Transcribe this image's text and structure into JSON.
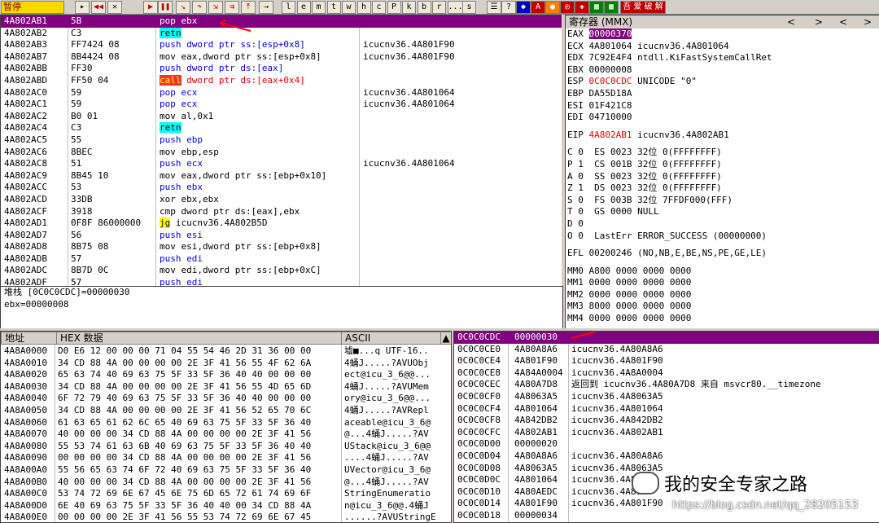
{
  "toolbar": {
    "status": "暂停",
    "buttons": [
      "l",
      "e",
      "m",
      "t",
      "w",
      "h",
      "c",
      "P",
      "k",
      "b",
      "r",
      "...",
      "s"
    ]
  },
  "disasm": {
    "rows": [
      {
        "addr": "4A802AB1",
        "hex": "5B",
        "asm": "pop ebx",
        "cmt": ""
      },
      {
        "addr": "4A802AB2",
        "hex": "C3",
        "asm": "retn",
        "cmt": ""
      },
      {
        "addr": "4A802AB3",
        "hex": "FF7424 08",
        "asm": "push dword ptr ss:[esp+0x8]",
        "cmt": "icucnv36.4A801F90"
      },
      {
        "addr": "4A802AB7",
        "hex": "8B4424 08",
        "asm": "mov eax,dword ptr ss:[esp+0x8]",
        "cmt": "icucnv36.4A801F90"
      },
      {
        "addr": "4A802ABB",
        "hex": "FF30",
        "asm": "push dword ptr ds:[eax]",
        "cmt": ""
      },
      {
        "addr": "4A802ABD",
        "hex": "FF50 04",
        "asm": "call dword ptr ds:[eax+0x4]",
        "cmt": ""
      },
      {
        "addr": "4A802AC0",
        "hex": "59",
        "asm": "pop ecx",
        "cmt": "icucnv36.4A801064"
      },
      {
        "addr": "4A802AC1",
        "hex": "59",
        "asm": "pop ecx",
        "cmt": "icucnv36.4A801064"
      },
      {
        "addr": "4A802AC2",
        "hex": "B0 01",
        "asm": "mov al,0x1",
        "cmt": ""
      },
      {
        "addr": "4A802AC4",
        "hex": "C3",
        "asm": "retn",
        "cmt": ""
      },
      {
        "addr": "4A802AC5",
        "hex": "55",
        "asm": "push ebp",
        "cmt": ""
      },
      {
        "addr": "4A802AC6",
        "hex": "8BEC",
        "asm": "mov ebp,esp",
        "cmt": ""
      },
      {
        "addr": "4A802AC8",
        "hex": "51",
        "asm": "push ecx",
        "cmt": "icucnv36.4A801064"
      },
      {
        "addr": "4A802AC9",
        "hex": "8B45 10",
        "asm": "mov eax,dword ptr ss:[ebp+0x10]",
        "cmt": ""
      },
      {
        "addr": "4A802ACC",
        "hex": "53",
        "asm": "push ebx",
        "cmt": ""
      },
      {
        "addr": "4A802ACD",
        "hex": "33DB",
        "asm": "xor ebx,ebx",
        "cmt": ""
      },
      {
        "addr": "4A802ACF",
        "hex": "3918",
        "asm": "cmp dword ptr ds:[eax],ebx",
        "cmt": ""
      },
      {
        "addr": "4A802AD1",
        "hex": "0F8F 86000000",
        "asm": "jg icucnv36.4A802B5D",
        "cmt": ""
      },
      {
        "addr": "4A802AD7",
        "hex": "56",
        "asm": "push esi",
        "cmt": ""
      },
      {
        "addr": "4A802AD8",
        "hex": "8B75 08",
        "asm": "mov esi,dword ptr ss:[ebp+0x8]",
        "cmt": ""
      },
      {
        "addr": "4A802ADB",
        "hex": "57",
        "asm": "push edi",
        "cmt": ""
      },
      {
        "addr": "4A802ADC",
        "hex": "8B7D 0C",
        "asm": "mov edi,dword ptr ss:[ebp+0xC]",
        "cmt": ""
      },
      {
        "addr": "4A802ADF",
        "hex": "57",
        "asm": "push edi",
        "cmt": ""
      }
    ]
  },
  "info": {
    "line1": "堆栈 [0C0C0CDC]=00000030",
    "line2": "ebx=00000008"
  },
  "registers": {
    "title": "寄存器 (MMX)",
    "lines": [
      "EAX 00000370",
      "ECX 4A801064 icucnv36.4A801064",
      "EDX 7C92E4F4 ntdll.KiFastSystemCallRet",
      "EBX 00000008",
      "ESP 0C0C0CDC UNICODE \"0\"",
      "EBP DA55D18A",
      "ESI 01F421C8",
      "EDI 04710000",
      "",
      "EIP 4A802AB1 icucnv36.4A802AB1",
      "",
      "C 0  ES 0023 32位 0(FFFFFFFF)",
      "P 1  CS 001B 32位 0(FFFFFFFF)",
      "A 0  SS 0023 32位 0(FFFFFFFF)",
      "Z 1  DS 0023 32位 0(FFFFFFFF)",
      "S 0  FS 003B 32位 7FFDF000(FFF)",
      "T 0  GS 0000 NULL",
      "D 0",
      "O 0  LastErr ERROR_SUCCESS (00000000)",
      "",
      "EFL 00200246 (NO,NB,E,BE,NS,PE,GE,LE)",
      "",
      "MM0 A800 0000 0000 0000",
      "MM1 0000 0000 0000 0000",
      "MM2 0000 0000 0000 0000",
      "MM3 8000 0000 0000 0000",
      "MM4 0000 0000 0000 0000"
    ]
  },
  "dump": {
    "headers": {
      "addr": "地址",
      "hex": "HEX 数据",
      "ascii": "ASCII"
    },
    "rows": [
      {
        "addr": "4A8A0000",
        "hex": "D0 E6 12 00 00 00 71 04 55 54 46 2D 31 36 00 00",
        "ascii": "墟■...q UTF-16.."
      },
      {
        "addr": "4A8A0010",
        "hex": "34 CD 88 4A 00 00 00 00 2E 3F 41 56 55 4F 62 6A",
        "ascii": "4蛹J.....?AVUObj"
      },
      {
        "addr": "4A8A0020",
        "hex": "65 63 74 40 69 63 75 5F 33 5F 36 40 40 00 00 00",
        "ascii": "ect@icu_3_6@@..."
      },
      {
        "addr": "4A8A0030",
        "hex": "34 CD 88 4A 00 00 00 00 2E 3F 41 56 55 4D 65 6D",
        "ascii": "4蛹J.....?AVUMem"
      },
      {
        "addr": "4A8A0040",
        "hex": "6F 72 79 40 69 63 75 5F 33 5F 36 40 40 00 00 00",
        "ascii": "ory@icu_3_6@@..."
      },
      {
        "addr": "4A8A0050",
        "hex": "34 CD 88 4A 00 00 00 00 2E 3F 41 56 52 65 70 6C",
        "ascii": "4蛹J.....?AVRepl"
      },
      {
        "addr": "4A8A0060",
        "hex": "61 63 65 61 62 6C 65 40 69 63 75 5F 33 5F 36 40",
        "ascii": "aceable@icu_3_6@"
      },
      {
        "addr": "4A8A0070",
        "hex": "40 00 00 00 34 CD 88 4A 00 00 00 00 2E 3F 41 56",
        "ascii": "@...4蛹J.....?AV"
      },
      {
        "addr": "4A8A0080",
        "hex": "55 53 74 61 63 6B 40 69 63 75 5F 33 5F 36 40 40",
        "ascii": "UStack@icu_3_6@@"
      },
      {
        "addr": "4A8A0090",
        "hex": "00 00 00 00 34 CD 88 4A 00 00 00 00 2E 3F 41 56",
        "ascii": "....4蛹J.....?AV"
      },
      {
        "addr": "4A8A00A0",
        "hex": "55 56 65 63 74 6F 72 40 69 63 75 5F 33 5F 36 40",
        "ascii": "UVector@icu_3_6@"
      },
      {
        "addr": "4A8A00B0",
        "hex": "40 00 00 00 34 CD 88 4A 00 00 00 00 2E 3F 41 56",
        "ascii": "@...4蛹J.....?AV"
      },
      {
        "addr": "4A8A00C0",
        "hex": "53 74 72 69 6E 67 45 6E 75 6D 65 72 61 74 69 6F",
        "ascii": "StringEnumeratio"
      },
      {
        "addr": "4A8A00D0",
        "hex": "6E 40 69 63 75 5F 33 5F 36 40 40 00 34 CD 88 4A",
        "ascii": "n@icu_3_6@@.4蛹J"
      },
      {
        "addr": "4A8A00E0",
        "hex": "00 00 00 00 2E 3F 41 56 55 53 74 72 69 6E 67 45",
        "ascii": "......?AVUStringE"
      }
    ]
  },
  "stack": {
    "rows": [
      {
        "addr": "0C0C0CDC",
        "val": "00000030",
        "cmt": ""
      },
      {
        "addr": "0C0C0CE0",
        "val": "4A80A8A6",
        "cmt": "icucnv36.4A80A8A6"
      },
      {
        "addr": "0C0C0CE4",
        "val": "4A801F90",
        "cmt": "icucnv36.4A801F90"
      },
      {
        "addr": "0C0C0CE8",
        "val": "4A84A0004",
        "cmt": "icucnv36.4A8A0004"
      },
      {
        "addr": "0C0C0CEC",
        "val": "4A80A7D8",
        "cmt": "返回到 icucnv36.4A80A7D8 来自 msvcr80.__timezone"
      },
      {
        "addr": "0C0C0CF0",
        "val": "4A8063A5",
        "cmt": "icucnv36.4A8063A5"
      },
      {
        "addr": "0C0C0CF4",
        "val": "4A801064",
        "cmt": "icucnv36.4A801064"
      },
      {
        "addr": "0C0C0CF8",
        "val": "4A842DB2",
        "cmt": "icucnv36.4A842DB2"
      },
      {
        "addr": "0C0C0CFC",
        "val": "4A802AB1",
        "cmt": "icucnv36.4A802AB1"
      },
      {
        "addr": "0C0C0D00",
        "val": "00000020",
        "cmt": ""
      },
      {
        "addr": "0C0C0D04",
        "val": "4A80A8A6",
        "cmt": "icucnv36.4A80A8A6"
      },
      {
        "addr": "0C0C0D08",
        "val": "4A8063A5",
        "cmt": "icucnv36.4A8063A5"
      },
      {
        "addr": "0C0C0D0C",
        "val": "4A801064",
        "cmt": "icucnv36.4A80"
      },
      {
        "addr": "0C0C0D10",
        "val": "4A80AEDC",
        "cmt": "icucnv36.4A80"
      },
      {
        "addr": "0C0C0D14",
        "val": "4A801F90",
        "cmt": "icucnv36.4A801F90"
      },
      {
        "addr": "0C0C0D18",
        "val": "00000034",
        "cmt": ""
      }
    ]
  },
  "watermark": {
    "title": "我的安全专家之路",
    "url": "https://blog.csdn.net/qq_28205153"
  },
  "colors": {
    "select": "#800080",
    "call": "#ff3030",
    "retn": "#00ffff",
    "jmp": "#ffff00",
    "push": "#0000ff"
  }
}
